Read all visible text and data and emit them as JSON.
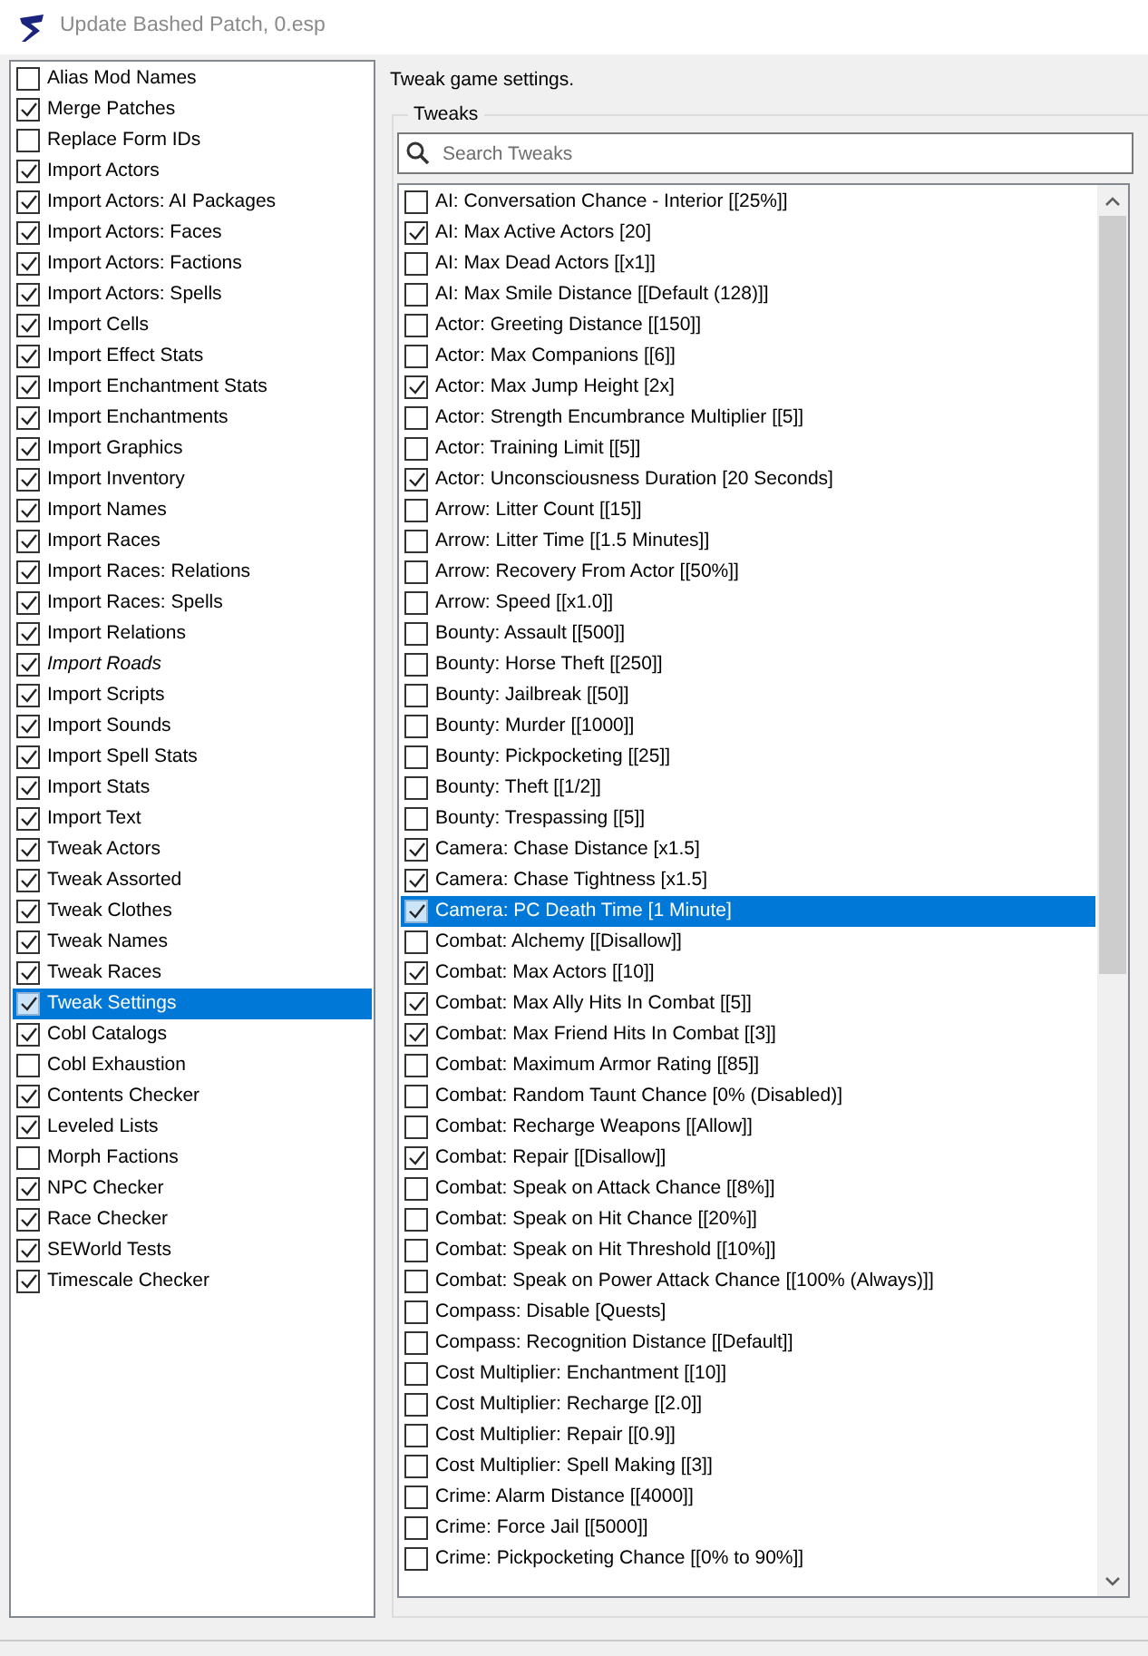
{
  "window": {
    "title": "Update Bashed Patch, 0.esp"
  },
  "patchers": [
    {
      "label": "Alias Mod Names",
      "checked": false,
      "selected": false,
      "italic": false
    },
    {
      "label": "Merge Patches",
      "checked": true,
      "selected": false,
      "italic": false
    },
    {
      "label": "Replace Form IDs",
      "checked": false,
      "selected": false,
      "italic": false
    },
    {
      "label": "Import Actors",
      "checked": true,
      "selected": false,
      "italic": false
    },
    {
      "label": "Import Actors: AI Packages",
      "checked": true,
      "selected": false,
      "italic": false
    },
    {
      "label": "Import Actors: Faces",
      "checked": true,
      "selected": false,
      "italic": false
    },
    {
      "label": "Import Actors: Factions",
      "checked": true,
      "selected": false,
      "italic": false
    },
    {
      "label": "Import Actors: Spells",
      "checked": true,
      "selected": false,
      "italic": false
    },
    {
      "label": "Import Cells",
      "checked": true,
      "selected": false,
      "italic": false
    },
    {
      "label": "Import Effect Stats",
      "checked": true,
      "selected": false,
      "italic": false
    },
    {
      "label": "Import Enchantment Stats",
      "checked": true,
      "selected": false,
      "italic": false
    },
    {
      "label": "Import Enchantments",
      "checked": true,
      "selected": false,
      "italic": false
    },
    {
      "label": "Import Graphics",
      "checked": true,
      "selected": false,
      "italic": false
    },
    {
      "label": "Import Inventory",
      "checked": true,
      "selected": false,
      "italic": false
    },
    {
      "label": "Import Names",
      "checked": true,
      "selected": false,
      "italic": false
    },
    {
      "label": "Import Races",
      "checked": true,
      "selected": false,
      "italic": false
    },
    {
      "label": "Import Races: Relations",
      "checked": true,
      "selected": false,
      "italic": false
    },
    {
      "label": "Import Races: Spells",
      "checked": true,
      "selected": false,
      "italic": false
    },
    {
      "label": "Import Relations",
      "checked": true,
      "selected": false,
      "italic": false
    },
    {
      "label": "Import Roads",
      "checked": true,
      "selected": false,
      "italic": true
    },
    {
      "label": "Import Scripts",
      "checked": true,
      "selected": false,
      "italic": false
    },
    {
      "label": "Import Sounds",
      "checked": true,
      "selected": false,
      "italic": false
    },
    {
      "label": "Import Spell Stats",
      "checked": true,
      "selected": false,
      "italic": false
    },
    {
      "label": "Import Stats",
      "checked": true,
      "selected": false,
      "italic": false
    },
    {
      "label": "Import Text",
      "checked": true,
      "selected": false,
      "italic": false
    },
    {
      "label": "Tweak Actors",
      "checked": true,
      "selected": false,
      "italic": false
    },
    {
      "label": "Tweak Assorted",
      "checked": true,
      "selected": false,
      "italic": false
    },
    {
      "label": "Tweak Clothes",
      "checked": true,
      "selected": false,
      "italic": false
    },
    {
      "label": "Tweak Names",
      "checked": true,
      "selected": false,
      "italic": false
    },
    {
      "label": "Tweak Races",
      "checked": true,
      "selected": false,
      "italic": false
    },
    {
      "label": "Tweak Settings",
      "checked": true,
      "selected": true,
      "italic": false
    },
    {
      "label": "Cobl Catalogs",
      "checked": true,
      "selected": false,
      "italic": false
    },
    {
      "label": "Cobl Exhaustion",
      "checked": false,
      "selected": false,
      "italic": false
    },
    {
      "label": "Contents Checker",
      "checked": true,
      "selected": false,
      "italic": false
    },
    {
      "label": "Leveled Lists",
      "checked": true,
      "selected": false,
      "italic": false
    },
    {
      "label": "Morph Factions",
      "checked": false,
      "selected": false,
      "italic": false
    },
    {
      "label": "NPC Checker",
      "checked": true,
      "selected": false,
      "italic": false
    },
    {
      "label": "Race Checker",
      "checked": true,
      "selected": false,
      "italic": false
    },
    {
      "label": "SEWorld Tests",
      "checked": true,
      "selected": false,
      "italic": false
    },
    {
      "label": "Timescale Checker",
      "checked": true,
      "selected": false,
      "italic": false
    }
  ],
  "description": "Tweak game settings.",
  "tweaks": {
    "title": "Tweaks",
    "search": {
      "placeholder": "Search Tweaks"
    },
    "items": [
      {
        "label": "AI: Conversation Chance - Interior [[25%]]",
        "checked": false,
        "selected": false
      },
      {
        "label": "AI: Max Active Actors [20]",
        "checked": true,
        "selected": false
      },
      {
        "label": "AI: Max Dead Actors [[x1]]",
        "checked": false,
        "selected": false
      },
      {
        "label": "AI: Max Smile Distance [[Default (128)]]",
        "checked": false,
        "selected": false
      },
      {
        "label": "Actor: Greeting Distance [[150]]",
        "checked": false,
        "selected": false
      },
      {
        "label": "Actor: Max Companions [[6]]",
        "checked": false,
        "selected": false
      },
      {
        "label": "Actor: Max Jump Height [2x]",
        "checked": true,
        "selected": false
      },
      {
        "label": "Actor: Strength Encumbrance Multiplier [[5]]",
        "checked": false,
        "selected": false
      },
      {
        "label": "Actor: Training Limit [[5]]",
        "checked": false,
        "selected": false
      },
      {
        "label": "Actor: Unconsciousness Duration [20 Seconds]",
        "checked": true,
        "selected": false
      },
      {
        "label": "Arrow: Litter Count [[15]]",
        "checked": false,
        "selected": false
      },
      {
        "label": "Arrow: Litter Time [[1.5 Minutes]]",
        "checked": false,
        "selected": false
      },
      {
        "label": "Arrow: Recovery From Actor [[50%]]",
        "checked": false,
        "selected": false
      },
      {
        "label": "Arrow: Speed [[x1.0]]",
        "checked": false,
        "selected": false
      },
      {
        "label": "Bounty: Assault [[500]]",
        "checked": false,
        "selected": false
      },
      {
        "label": "Bounty: Horse Theft [[250]]",
        "checked": false,
        "selected": false
      },
      {
        "label": "Bounty: Jailbreak [[50]]",
        "checked": false,
        "selected": false
      },
      {
        "label": "Bounty: Murder [[1000]]",
        "checked": false,
        "selected": false
      },
      {
        "label": "Bounty: Pickpocketing [[25]]",
        "checked": false,
        "selected": false
      },
      {
        "label": "Bounty: Theft [[1/2]]",
        "checked": false,
        "selected": false
      },
      {
        "label": "Bounty: Trespassing [[5]]",
        "checked": false,
        "selected": false
      },
      {
        "label": "Camera: Chase Distance [x1.5]",
        "checked": true,
        "selected": false
      },
      {
        "label": "Camera: Chase Tightness [x1.5]",
        "checked": true,
        "selected": false
      },
      {
        "label": "Camera: PC Death Time [1 Minute]",
        "checked": true,
        "selected": true
      },
      {
        "label": "Combat: Alchemy [[Disallow]]",
        "checked": false,
        "selected": false
      },
      {
        "label": "Combat: Max Actors [[10]]",
        "checked": true,
        "selected": false
      },
      {
        "label": "Combat: Max Ally Hits In Combat [[5]]",
        "checked": true,
        "selected": false
      },
      {
        "label": "Combat: Max Friend Hits In Combat [[3]]",
        "checked": true,
        "selected": false
      },
      {
        "label": "Combat: Maximum Armor Rating [[85]]",
        "checked": false,
        "selected": false
      },
      {
        "label": "Combat: Random Taunt Chance [0% (Disabled)]",
        "checked": false,
        "selected": false
      },
      {
        "label": "Combat: Recharge Weapons [[Allow]]",
        "checked": false,
        "selected": false
      },
      {
        "label": "Combat: Repair [[Disallow]]",
        "checked": true,
        "selected": false
      },
      {
        "label": "Combat: Speak on Attack Chance [[8%]]",
        "checked": false,
        "selected": false
      },
      {
        "label": "Combat: Speak on Hit Chance [[20%]]",
        "checked": false,
        "selected": false
      },
      {
        "label": "Combat: Speak on Hit Threshold [[10%]]",
        "checked": false,
        "selected": false
      },
      {
        "label": "Combat: Speak on Power Attack Chance [[100% (Always)]]",
        "checked": false,
        "selected": false
      },
      {
        "label": "Compass: Disable [Quests]",
        "checked": false,
        "selected": false
      },
      {
        "label": "Compass: Recognition Distance [[Default]]",
        "checked": false,
        "selected": false
      },
      {
        "label": "Cost Multiplier: Enchantment [[10]]",
        "checked": false,
        "selected": false
      },
      {
        "label": "Cost Multiplier: Recharge [[2.0]]",
        "checked": false,
        "selected": false
      },
      {
        "label": "Cost Multiplier: Repair [[0.9]]",
        "checked": false,
        "selected": false
      },
      {
        "label": "Cost Multiplier: Spell Making [[3]]",
        "checked": false,
        "selected": false
      },
      {
        "label": "Crime: Alarm Distance [[4000]]",
        "checked": false,
        "selected": false
      },
      {
        "label": "Crime: Force Jail [[5000]]",
        "checked": false,
        "selected": false
      },
      {
        "label": "Crime: Pickpocketing Chance [[0% to 90%]]",
        "checked": false,
        "selected": false
      }
    ]
  }
}
